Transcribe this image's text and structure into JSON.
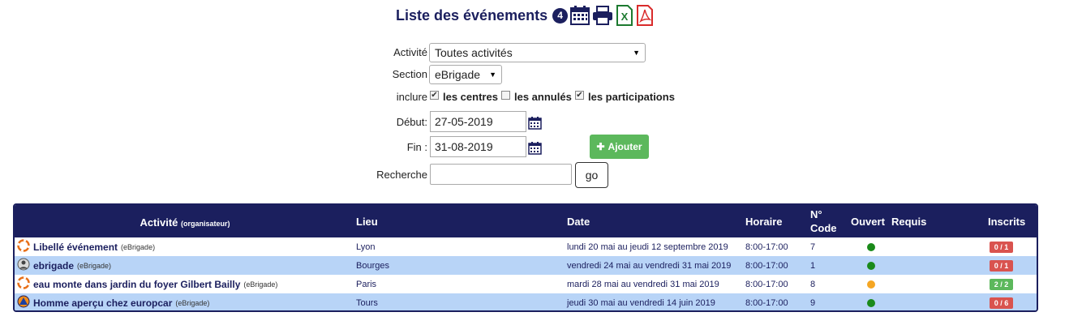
{
  "header": {
    "title": "Liste des événements",
    "count": "4"
  },
  "colors": {
    "brand": "#1b1f5e",
    "row_alt": "#b8d4f7",
    "add_button": "#5cb85c",
    "status_green": "#1a8a1a",
    "status_orange": "#f5a623",
    "inscrits_red": "#d9534f",
    "inscrits_green": "#5cb85c"
  },
  "form": {
    "activite": {
      "label": "Activité",
      "value": "Toutes activités"
    },
    "section": {
      "label": "Section",
      "value": "eBrigade"
    },
    "inclure": {
      "label": "inclure",
      "options": [
        {
          "label": "les centres",
          "checked": true
        },
        {
          "label": "les annulés",
          "checked": false
        },
        {
          "label": "les participations",
          "checked": true
        }
      ]
    },
    "debut": {
      "label": "Début:",
      "value": "27-05-2019"
    },
    "fin": {
      "label": "Fin :",
      "value": "31-08-2019"
    },
    "recherche": {
      "label": "Recherche",
      "value": ""
    },
    "add_label": "Ajouter",
    "go_label": "go"
  },
  "table": {
    "headers": {
      "activite": "Activité",
      "activite_sub": "(organisateur)",
      "lieu": "Lieu",
      "date": "Date",
      "horaire": "Horaire",
      "code": "N° Code",
      "ouvert": "Ouvert",
      "requis": "Requis",
      "inscrits": "Inscrits"
    },
    "rows": [
      {
        "icon": "lifebuoy-icon",
        "name": "Libellé événement",
        "org": "(eBrigade)",
        "lieu": "Lyon",
        "date": "lundi 20 mai au jeudi 12 septembre 2019",
        "horaire": "8:00-17:00",
        "code": "7",
        "ouvert": "green",
        "requis": "",
        "inscrits": "0 / 1",
        "inscrits_color": "red"
      },
      {
        "icon": "rescuer-icon",
        "name": "ebrigade",
        "org": "(eBrigade)",
        "lieu": "Bourges",
        "date": "vendredi 24 mai au vendredi 31 mai 2019",
        "horaire": "8:00-17:00",
        "code": "1",
        "ouvert": "green",
        "requis": "",
        "inscrits": "0 / 1",
        "inscrits_color": "red"
      },
      {
        "icon": "lifebuoy-icon",
        "name": "eau monte dans jardin du foyer Gilbert Bailly",
        "org": "(eBrigade)",
        "lieu": "Paris",
        "date": "mardi 28 mai au vendredi 31 mai 2019",
        "horaire": "8:00-17:00",
        "code": "8",
        "ouvert": "orange",
        "requis": "",
        "inscrits": "2 / 2",
        "inscrits_color": "green"
      },
      {
        "icon": "civil-protection-icon",
        "name": "Homme aperçu chez europcar",
        "org": "(eBrigade)",
        "lieu": "Tours",
        "date": "jeudi 30 mai au vendredi 14 juin 2019",
        "horaire": "8:00-17:00",
        "code": "9",
        "ouvert": "green",
        "requis": "",
        "inscrits": "0 / 6",
        "inscrits_color": "red"
      }
    ]
  }
}
